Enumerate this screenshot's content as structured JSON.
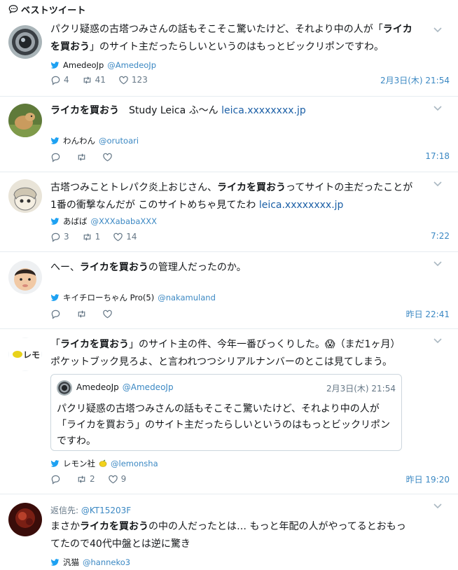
{
  "header": {
    "title": "ベストツイート",
    "icon": "speech-bubble-icon"
  },
  "colors": {
    "link": "#1b5fa6",
    "handle": "#3b88c3",
    "muted": "#657786",
    "twitter_blue": "#1da1f2",
    "divider": "#e6ecf0"
  },
  "tweets": [
    {
      "reply_label": "",
      "reply_handle": "",
      "text_lines": [
        [
          {
            "t": "パクリ疑惑の古塔つみさんの話もそこそこ驚いたけど、それより中の人が「"
          },
          {
            "t": "ライカ",
            "hl": true
          }
        ],
        [
          {
            "t": "を買おう",
            "hl": true
          },
          {
            "t": "」のサイト主だったらしいというのはもっとビックリポンですわ。"
          }
        ]
      ],
      "author_name": "AmedeoJp",
      "author_handle": "@AmedeoJp",
      "replies": "4",
      "retweets": "41",
      "likes": "123",
      "timestamp": "2月3日(木) 21:54"
    },
    {
      "reply_label": "",
      "reply_handle": "",
      "text_lines": [
        [
          {
            "t": "ライカを買おう",
            "hl": true
          },
          {
            "t": "　Study Leica ふ〜ん "
          },
          {
            "t": "leica.xxxxxxxx.jp",
            "link": true
          }
        ]
      ],
      "author_name": "わんわん",
      "author_handle": "@orutoari",
      "replies": "",
      "retweets": "",
      "likes": "",
      "timestamp": "17:18"
    },
    {
      "reply_label": "",
      "reply_handle": "",
      "text_lines": [
        [
          {
            "t": "古塔つみことトレパク炎上おじさん、"
          },
          {
            "t": "ライカを買おう",
            "hl": true
          },
          {
            "t": "ってサイトの主だったことが"
          }
        ],
        [
          {
            "t": "1番の衝撃なんだが このサイトめちゃ見てたわ "
          },
          {
            "t": "leica.xxxxxxxx.jp",
            "link": true
          }
        ]
      ],
      "author_name": "あばば",
      "author_handle": "@XXXababaXXX",
      "replies": "3",
      "retweets": "1",
      "likes": "14",
      "timestamp": "7:22"
    },
    {
      "reply_label": "",
      "reply_handle": "",
      "text_lines": [
        [
          {
            "t": "へー、"
          },
          {
            "t": "ライカを買おう",
            "hl": true
          },
          {
            "t": "の管理人だったのか。"
          }
        ]
      ],
      "author_name": "キイチローちゃん Pro(5)",
      "author_handle": "@nakamuland",
      "replies": "",
      "retweets": "",
      "likes": "",
      "timestamp": "昨日 22:41"
    },
    {
      "reply_label": "",
      "reply_handle": "",
      "text_lines": [
        [
          {
            "t": "「"
          },
          {
            "t": "ライカを買おう",
            "hl": true
          },
          {
            "t": "」のサイト主の件、今年一番びっくりした。😱（まだ1ヶ月）"
          }
        ],
        [
          {
            "t": "ポケットブック見ろよ、と言われつつシリアルナンバーのとこは見てしまう。"
          }
        ]
      ],
      "quote": {
        "name": "AmedeoJp",
        "handle": "@AmedeoJp",
        "time": "2月3日(木) 21:54",
        "lines": [
          "パクリ疑惑の古塔つみさんの話もそこそこ驚いたけど、それより中の人が",
          "「ライカを買おう」のサイト主だったらしいというのはもっとビックリポン",
          "ですわ。"
        ]
      },
      "author_name": "レモン社",
      "author_handle": "@lemonsha",
      "replies": "",
      "retweets": "2",
      "likes": "9",
      "timestamp": "昨日 19:20"
    },
    {
      "reply_label": "返信先: ",
      "reply_handle": "@KT15203F",
      "text_lines": [
        [
          {
            "t": "まさか"
          },
          {
            "t": "ライカを買おう",
            "hl": true
          },
          {
            "t": "の中の人だったとは… もっと年配の人がやってるとおもっ"
          }
        ],
        [
          {
            "t": "てたので40代中盤とは逆に驚き"
          }
        ]
      ],
      "author_name": "汎猫",
      "author_handle": "@hanneko3",
      "replies": "",
      "retweets": "",
      "likes": "",
      "timestamp": ""
    }
  ]
}
